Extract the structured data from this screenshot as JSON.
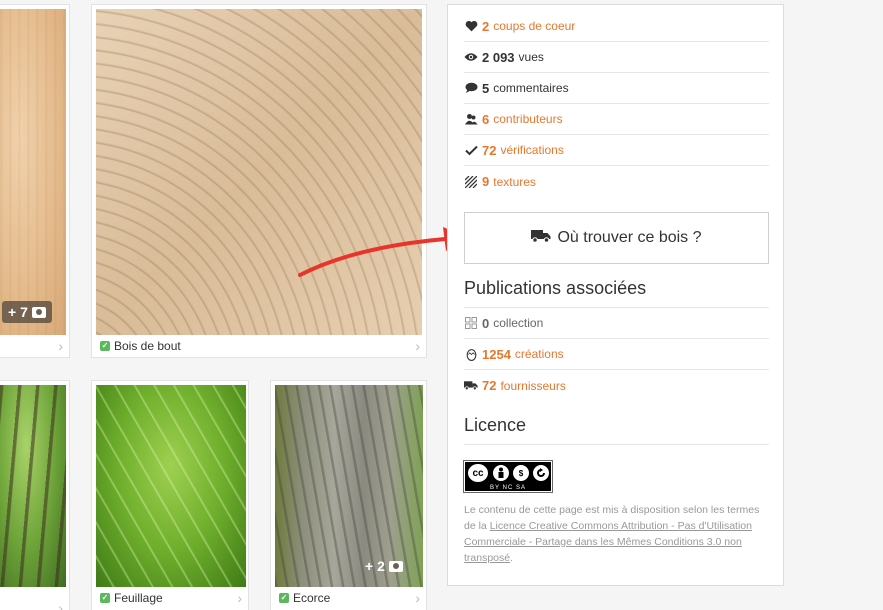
{
  "cards": {
    "left_top": {
      "badge": "+ 7"
    },
    "main": {
      "caption": "Bois de bout"
    },
    "leaf": {
      "caption": "Feuillage"
    },
    "bark": {
      "caption": "Ecorce",
      "badge": "+ 2"
    }
  },
  "stats": [
    {
      "icon": "heart-icon",
      "num": "2",
      "label": "coups de coeur",
      "style": "orange"
    },
    {
      "icon": "eye-icon",
      "num": "2 093",
      "label": "vues",
      "style": "dark"
    },
    {
      "icon": "comment-icon",
      "num": "5",
      "label": "commentaires",
      "style": "dark"
    },
    {
      "icon": "users-icon",
      "num": "6",
      "label": "contributeurs",
      "style": "orange"
    },
    {
      "icon": "check-icon",
      "num": "72",
      "label": "vérifications",
      "style": "orange"
    },
    {
      "icon": "texture-icon",
      "num": "9",
      "label": "textures",
      "style": "orange"
    }
  ],
  "find_button": {
    "label": "Où trouver ce bois ?"
  },
  "publications": {
    "title": "Publications associées",
    "items": [
      {
        "icon": "grid-icon",
        "num": "0",
        "label": "collection",
        "style": "grey"
      },
      {
        "icon": "egg-icon",
        "num": "1254",
        "label": "créations",
        "style": "orange"
      },
      {
        "icon": "truck-icon",
        "num": "72",
        "label": "fournisseurs",
        "style": "orange"
      }
    ]
  },
  "license": {
    "title": "Licence",
    "cc_top": [
      "cc",
      "BY",
      "$",
      "="
    ],
    "cc_bottom": "BY NC SA",
    "text_before": "Le contenu de cette page est mis à disposition selon les termes de la ",
    "link": "Licence Creative Commons Attribution - Pas d'Utilisation Commerciale - Partage dans les Mêmes Conditions 3.0 non transposé",
    "text_after": "."
  },
  "colors": {
    "accent": "#e8772e",
    "arrow": "#e8342a",
    "check": "#5cb85c"
  }
}
